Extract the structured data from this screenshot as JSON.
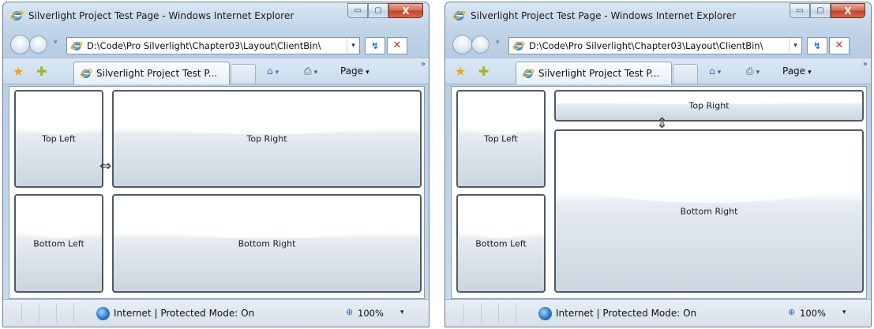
{
  "windows": [
    {
      "title": "Silverlight Project Test Page - Windows Internet Explorer",
      "address": "D:\\Code\\Pro Silverlight\\Chapter03\\Layout\\ClientBin\\",
      "tab_label": "Silverlight Project Test P...",
      "page_menu": "Page",
      "status": "Internet | Protected Mode: On",
      "zoom": "100%",
      "panes": {
        "top_left": "Top Left",
        "top_right": "Top Right",
        "bottom_left": "Bottom Left",
        "bottom_right": "Bottom Right"
      },
      "splitter_cursor": "⇔"
    },
    {
      "title": "Silverlight Project Test Page - Windows Internet Explorer",
      "address": "D:\\Code\\Pro Silverlight\\Chapter03\\Layout\\ClientBin\\",
      "tab_label": "Silverlight Project Test P...",
      "page_menu": "Page",
      "status": "Internet | Protected Mode: On",
      "zoom": "100%",
      "panes": {
        "top_left": "Top Left",
        "top_right": "Top Right",
        "bottom_left": "Bottom Left",
        "bottom_right": "Bottom Right"
      },
      "splitter_cursor": "⇕"
    }
  ],
  "icons": {
    "caption_minimize": "▭",
    "caption_maximize": "▢",
    "caption_close": "X",
    "favorites": "★",
    "add_favorites": "✚",
    "home": "⌂",
    "print": "⎙",
    "more": "»",
    "dropdown": "▾",
    "refresh": "↯",
    "stop": "✕"
  },
  "colors": {
    "title_gradient_top": "#d9e7f4",
    "close_button": "#c0432a",
    "pane_border": "#4e5a66"
  }
}
